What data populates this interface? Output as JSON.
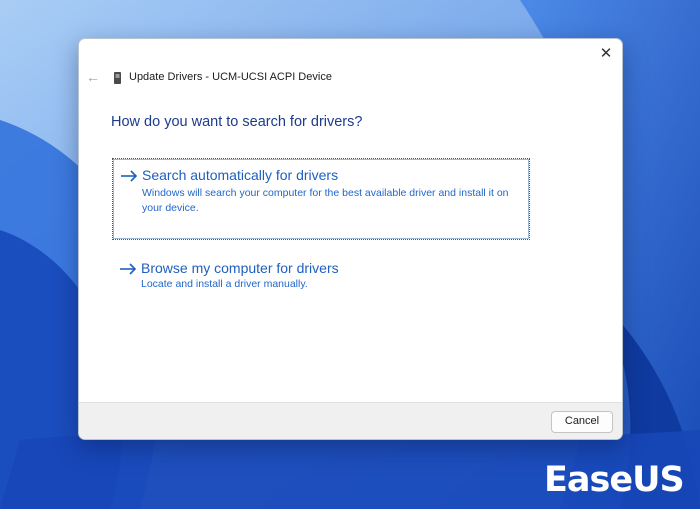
{
  "dialog": {
    "title": "Update Drivers - UCM-UCSI ACPI Device",
    "heading": "How do you want to search for drivers?",
    "close_symbol": "✕",
    "back_symbol": "←",
    "options": [
      {
        "title": "Search automatically for drivers",
        "description": "Windows will search your computer for the best available driver and install it on your device.",
        "icon": "arrow-right-icon"
      },
      {
        "title": "Browse my computer for drivers",
        "description": "Locate and install a driver manually.",
        "icon": "arrow-right-icon"
      }
    ],
    "cancel_label": "Cancel"
  },
  "brand": {
    "logo_text": "EaseUS"
  },
  "colors": {
    "link": "#1f5fbf",
    "heading": "#1b3b8c",
    "wallpaper": "#2f6fd8"
  }
}
